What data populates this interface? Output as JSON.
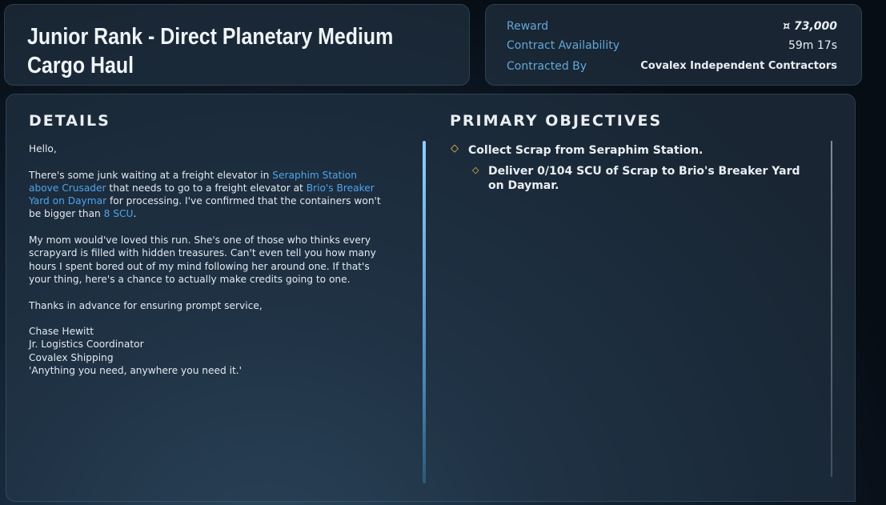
{
  "header": {
    "title": "Junior Rank - Direct Planetary Medium Cargo Haul"
  },
  "info": {
    "reward_label": "Reward",
    "reward_value": "¤ 73,000",
    "availability_label": "Contract Availability",
    "availability_value": "59m 17s",
    "contracted_by_label": "Contracted By",
    "contracted_by_value": "Covalex Independent Contractors"
  },
  "details": {
    "heading": "DETAILS",
    "greeting": "Hello,",
    "p1_a": "There's some junk waiting at a freight elevator in ",
    "p1_link1": "Seraphim Station above Crusader",
    "p1_b": " that needs to go to a freight elevator at ",
    "p1_link2": "Brio's Breaker Yard on Daymar",
    "p1_c": " for processing. I've confirmed that the containers won't be bigger than ",
    "p1_link3": "8 SCU",
    "p1_d": ".",
    "p2": "My mom would've loved this run. She's one of those who thinks every scrapyard is filled with hidden treasures. Can't even tell you how many hours I spent bored out of my mind following her around one. If that's your thing, here's a chance to actually make credits going to one.",
    "p3": "Thanks in advance for ensuring prompt service,",
    "sig_name": "Chase Hewitt",
    "sig_title": "Jr. Logistics Coordinator",
    "sig_company": "Covalex Shipping",
    "sig_motto": "'Anything you need, anywhere you need it.'"
  },
  "objectives": {
    "heading": "PRIMARY OBJECTIVES",
    "items": [
      {
        "text": "Collect Scrap from Seraphim Station."
      },
      {
        "text": "Deliver 0/104 SCU of Scrap to Brio's Breaker Yard on Daymar."
      }
    ],
    "icon": "diamond-icon",
    "accent_color": "#f1c84a"
  },
  "colors": {
    "link": "#4fa3ea",
    "label": "#63a7d8"
  }
}
